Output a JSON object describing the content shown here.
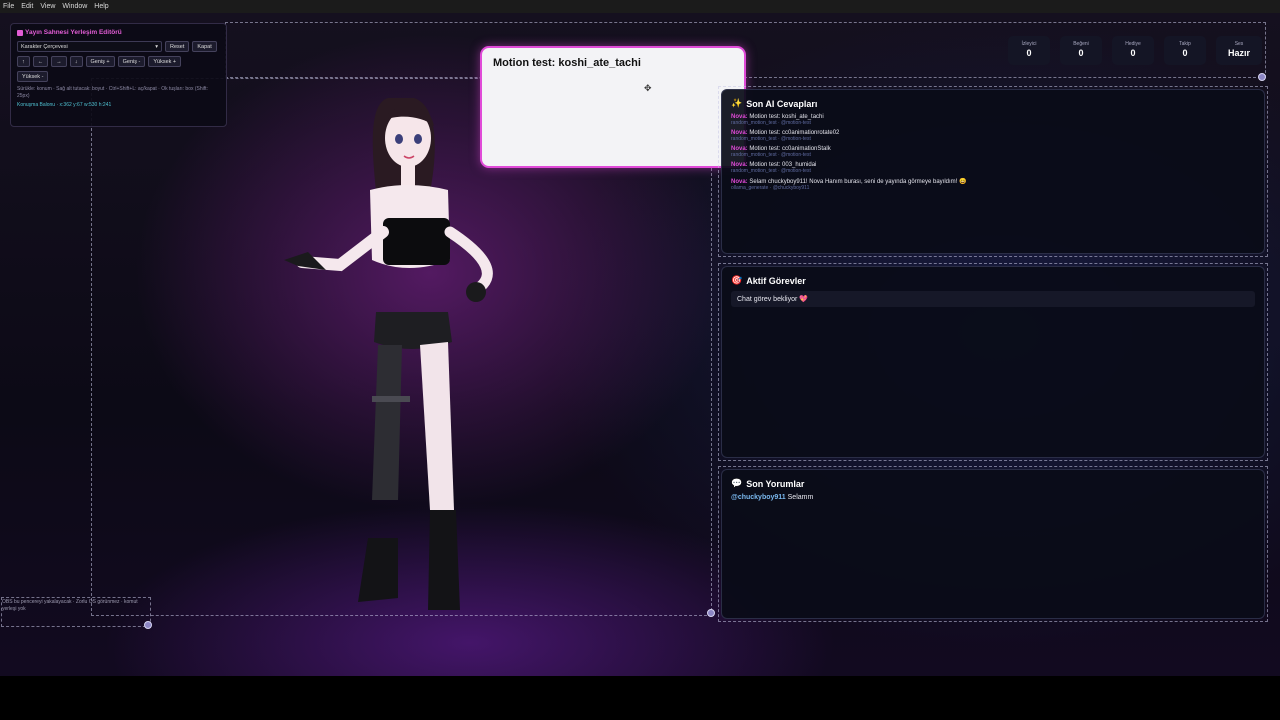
{
  "menu": [
    "File",
    "Edit",
    "View",
    "Window",
    "Help"
  ],
  "editor": {
    "title": "Yayın Sahnesi Yerleşim Editörü",
    "select_value": "Karakter Çerçevesi",
    "reset_label": "Reset",
    "close_label": "Kapat",
    "arrows": [
      "↑",
      "←",
      "→",
      "↓"
    ],
    "size_buttons": [
      "Geniş +",
      "Geniş -",
      "Yüksek +",
      "Yüksek -"
    ],
    "hint": "Sürükle: konum · Sağ alt tutacak: boyut · Ctrl+Shift+L: aç/kapat · Ok tuşları: box (Shift: 25px)",
    "position_label": "Konuşma Balonu · x:362 y:67 w:530 h:241"
  },
  "bubble": {
    "text": "Motion test: koshi_ate_tachi",
    "move_icon": "✥"
  },
  "stats": [
    {
      "label": "İzleyici",
      "value": "0"
    },
    {
      "label": "Beğeni",
      "value": "0"
    },
    {
      "label": "Hediye",
      "value": "0"
    },
    {
      "label": "Takip",
      "value": "0"
    },
    {
      "label": "Ses",
      "value": "Hazır"
    }
  ],
  "ai_panel": {
    "icon": "✨",
    "title": "Son AI Cevapları",
    "items": [
      {
        "name": "Nova:",
        "text": "Motion test: koshi_ate_tachi",
        "meta": "random_motion_test · @motion-test"
      },
      {
        "name": "Nova:",
        "text": "Motion test: cc0animationrotate02",
        "meta": "random_motion_test · @motion-test"
      },
      {
        "name": "Nova:",
        "text": "Motion test: cc0animationStalk",
        "meta": "random_motion_test · @motion-test"
      },
      {
        "name": "Nova:",
        "text": "Motion test: 003_humidai",
        "meta": "random_motion_test · @motion-test"
      },
      {
        "name": "Nova:",
        "text": "Selam chuckyboy911! Nova Hanım burası, seni de yayında görmeye bayıldım! 😄",
        "meta": "ollama_generate · @chuckyboy911"
      }
    ]
  },
  "tasks_panel": {
    "icon": "🎯",
    "title": "Aktif Görevler",
    "items": [
      "Chat görev bekliyor 💖"
    ]
  },
  "comments_panel": {
    "icon": "💬",
    "title": "Son Yorumlar",
    "items": [
      {
        "user": "@chuckyboy911",
        "text": "Selamm"
      }
    ]
  },
  "obs_note": "OBS bu pencereyi yakalayacak · Zorlu OS görünmez · komut yerleşi yok",
  "colors": {
    "accent": "#e04ad8",
    "link": "#7ab8ee",
    "stage_purple": "#5f1c6e"
  }
}
